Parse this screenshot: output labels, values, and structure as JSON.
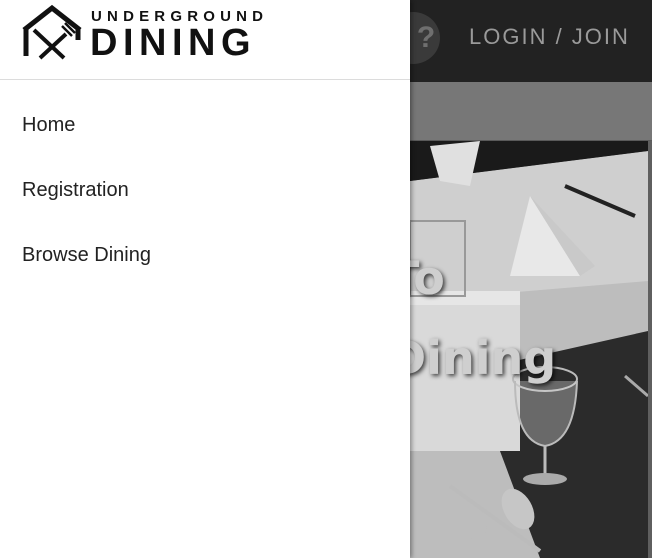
{
  "header": {
    "help_icon": "question-mark-icon",
    "help_label": "?",
    "login_label": "LOGIN / JOIN"
  },
  "hero": {
    "line1": "To",
    "line2": "Dining"
  },
  "drawer": {
    "logo": {
      "top_text": "UNDERGROUND",
      "main_text": "DINING",
      "icon": "house-fork-knife-icon"
    },
    "items": [
      {
        "label": "Home"
      },
      {
        "label": "Registration"
      },
      {
        "label": "Browse Dining"
      }
    ]
  },
  "colors": {
    "topbar": "#222222",
    "drawer_bg": "#ffffff",
    "text": "#222222"
  }
}
